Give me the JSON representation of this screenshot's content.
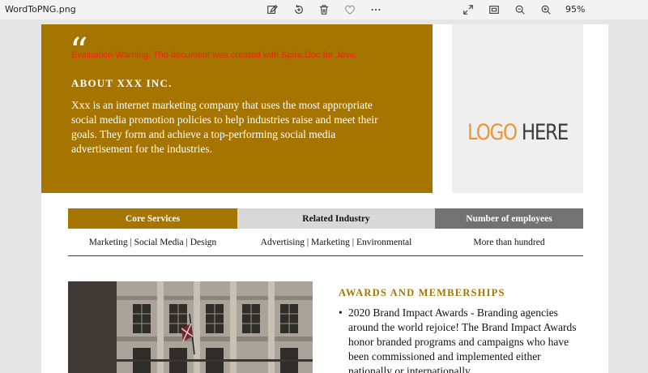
{
  "window": {
    "filename": "WordToPNG.png",
    "zoom": "95%"
  },
  "toolbar": {
    "icons": [
      "edit-image-icon",
      "rotate-icon",
      "delete-icon",
      "favorite-heart-icon",
      "more-options-icon",
      "expand-icon",
      "fit-screen-icon",
      "zoom-out-icon",
      "zoom-in-icon"
    ]
  },
  "hero": {
    "quote_mark": "“",
    "evaluation_warning": "Evaluation Warning: The document was created with Spire.Doc for Java.",
    "about_title": "ABOUT XXX INC.",
    "about_text": "Xxx is an internet marketing company that uses the most appropriate social media promotion policies to help industries raise and meet their goals. They form and achieve a top-performing social media advertisement for the industries."
  },
  "logo": {
    "word1": "LOGO",
    "word2": "HERE",
    "colors": {
      "word1": "#e8963a",
      "word2": "#3d3d3d"
    }
  },
  "info_table": {
    "headers": [
      "Core Services",
      "Related Industry",
      "Number of employees"
    ],
    "values": [
      "Marketing | Social Media | Design",
      "Advertising | Marketing | Environmental",
      "More than hundred"
    ],
    "header_colors": [
      "#a67500",
      "#d8d8d8",
      "#727272"
    ]
  },
  "awards": {
    "title": "AWARDS AND MEMBERSHIPS",
    "items": [
      "2020 Brand Impact Awards - Branding agencies around the world rejoice! The Brand Impact Awards honor branded programs and campaigns who have been commissioned and implemented either nationally or internationally."
    ]
  },
  "colors": {
    "accent": "#a67500",
    "warning": "#ff1a1a"
  }
}
